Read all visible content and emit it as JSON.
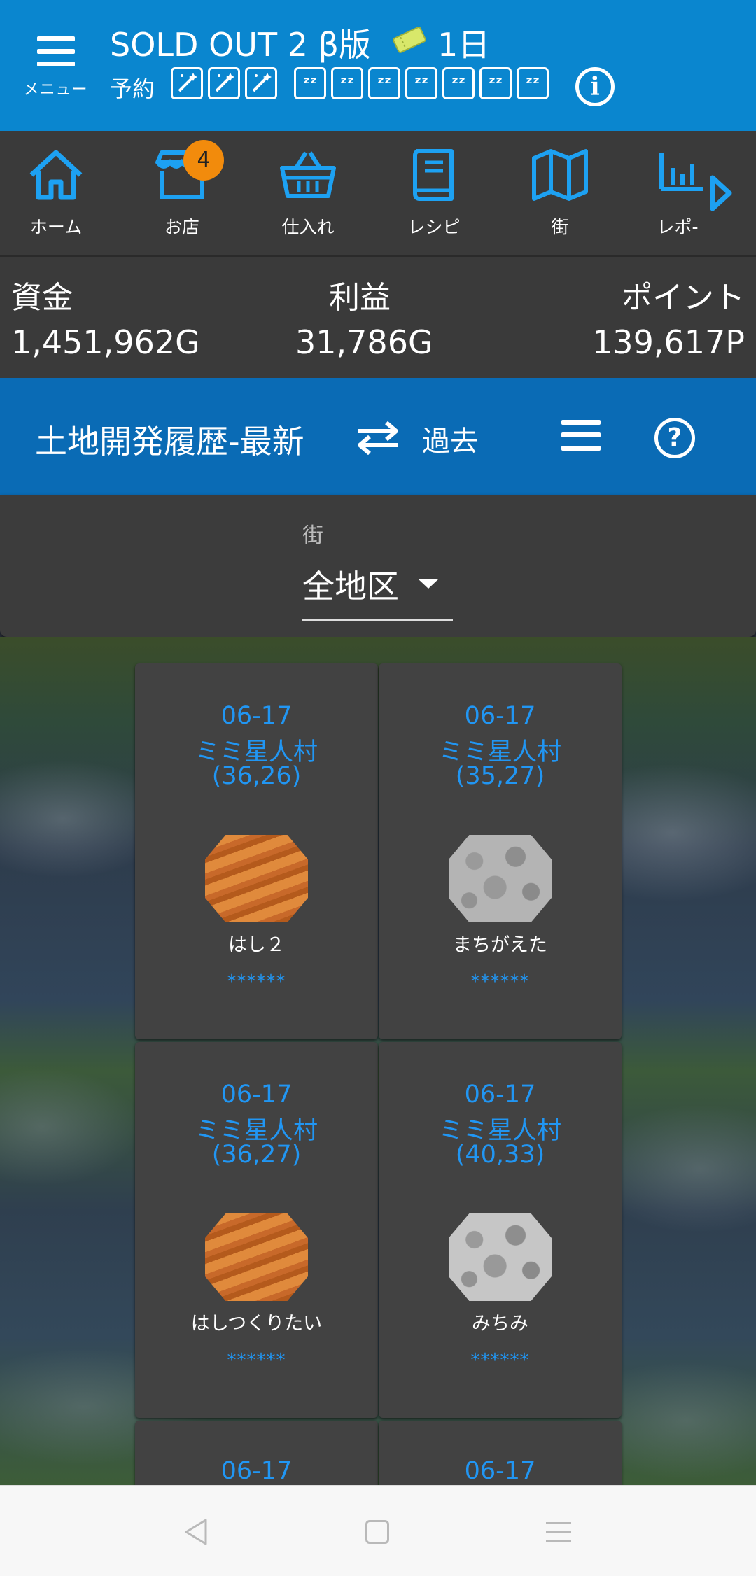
{
  "header": {
    "menu_label": "メニュー",
    "title": "SOLD OUT 2 β版",
    "day": "1日",
    "reserve_label": "予約",
    "magic_slots": [
      "magic-wand-icon",
      "magic-wand-icon",
      "magic-wand-icon"
    ],
    "sleep_slots": [
      "zzz-icon",
      "zzz-icon",
      "zzz-icon",
      "zzz-icon",
      "zzz-icon",
      "zzz-icon",
      "zzz-icon"
    ],
    "sleep_glyph": "ᶻᶻ",
    "info_glyph": "i"
  },
  "nav": {
    "items": [
      {
        "label": "ホーム",
        "icon": "home-icon"
      },
      {
        "label": "お店",
        "icon": "shop-icon",
        "badge": "4"
      },
      {
        "label": "仕入れ",
        "icon": "basket-icon"
      },
      {
        "label": "レシピ",
        "icon": "book-icon"
      },
      {
        "label": "街",
        "icon": "map-icon"
      },
      {
        "label": "レポ-",
        "icon": "chart-icon"
      }
    ]
  },
  "stats": {
    "funds_label": "資金",
    "funds_value": "1,451,962G",
    "profit_label": "利益",
    "profit_value": "31,786G",
    "points_label": "ポイント",
    "points_value": "139,617P"
  },
  "section": {
    "title": "土地開発履歴-最新",
    "toggle_label": "過去",
    "help_glyph": "?"
  },
  "filter": {
    "label": "街",
    "value": "全地区"
  },
  "cards": [
    {
      "date": "06-17",
      "town": "ミミ星人村",
      "coord": "(36,26)",
      "name": "はし２",
      "stars": "******",
      "tile": "bridge"
    },
    {
      "date": "06-17",
      "town": "ミミ星人村",
      "coord": "(35,27)",
      "name": "まちがえた",
      "stars": "******",
      "tile": "stone"
    },
    {
      "date": "06-17",
      "town": "ミミ星人村",
      "coord": "(36,27)",
      "name": "はしつくりたい",
      "stars": "******",
      "tile": "bridge"
    },
    {
      "date": "06-17",
      "town": "ミミ星人村",
      "coord": "(40,33)",
      "name": "みちみ",
      "stars": "******",
      "tile": "stone"
    },
    {
      "date": "06-17"
    },
    {
      "date": "06-17"
    }
  ],
  "colors": {
    "header_blue": "#0a86cf",
    "section_blue": "#0a6bb5",
    "accent_blue": "#2196f3",
    "badge_orange": "#f28b0c",
    "panel_gray": "#3a3a3a",
    "card_gray": "#424242"
  }
}
